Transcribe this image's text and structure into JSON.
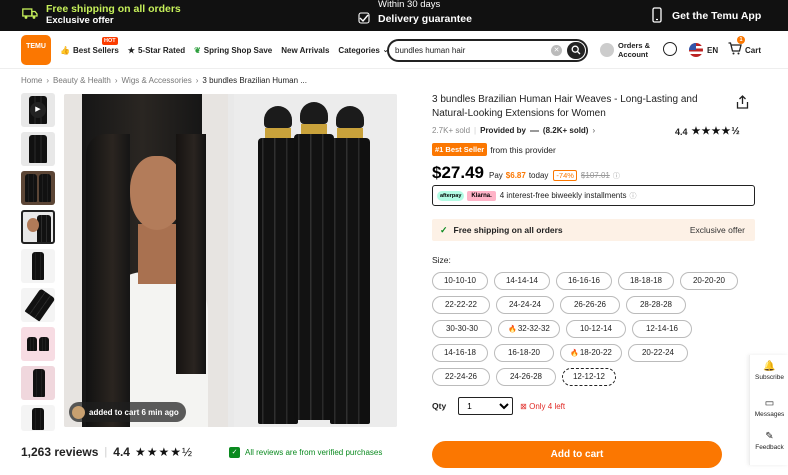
{
  "promo": {
    "free_shipping": "Free shipping on all orders",
    "exclusive_offer": "Exclusive offer",
    "within_days": "Within 30 days",
    "delivery_guarantee": "Delivery guarantee",
    "get_app": "Get the Temu App"
  },
  "nav": {
    "logo_text": "TEMU",
    "items": [
      {
        "label": "Best Sellers",
        "icon": "thumbs-up-icon"
      },
      {
        "label": "5-Star Rated",
        "icon": "star-icon"
      },
      {
        "label": "Spring Shop Save",
        "icon": "leaf-icon"
      },
      {
        "label": "New Arrivals",
        "icon": ""
      },
      {
        "label": "Categories",
        "icon": "chevron-down-icon"
      }
    ],
    "hot_badge": "HOT",
    "search_value": "bundles human hair",
    "account_label": "Orders & Account",
    "language": "EN",
    "cart_label": "Cart",
    "cart_count": "1"
  },
  "breadcrumb": {
    "home": "Home",
    "sep": "›",
    "level1": "Beauty & Health",
    "level2": "Wigs & Accessories",
    "current": "3 bundles Brazilian Human ..."
  },
  "gallery": {
    "toast": "added to cart 6 min ago"
  },
  "reviews": {
    "count": "1,263 reviews",
    "rating": "4.4",
    "stars": "★★★★½",
    "verified": "All reviews are from verified purchases"
  },
  "product": {
    "title": "3 bundles Brazilian Human Hair Weaves - Long-Lasting and Natural-Looking Extensions for Women",
    "sold": "2.7K+ sold",
    "provided_by": "Provided by",
    "provider_name": "(8.2K+ sold)",
    "rating": "4.4",
    "stars": "★★★★½",
    "best_seller": "#1 Best Seller",
    "best_from": "from this provider",
    "price": "$27.49",
    "pay": "Pay",
    "pay_amount": "$6.87",
    "today": "today",
    "discount": "-74%",
    "old_price": "$107.01",
    "bnpl_afterpay": "afterpay",
    "bnpl_klarna": "Klarna.",
    "bnpl_text": "4 interest-free biweekly installments",
    "shipping": "Free shipping on all orders",
    "exclusive": "Exclusive offer",
    "size_label": "Size:",
    "sizes": [
      "10-10-10",
      "14-14-14",
      "16-16-16",
      "18-18-18",
      "20-20-20",
      "22-22-22",
      "24-24-24",
      "26-26-26",
      "28-28-28",
      "30-30-30",
      "32-32-32",
      "10-12-14",
      "12-14-16",
      "14-16-18",
      "16-18-20",
      "18-20-22",
      "20-22-24",
      "22-24-26",
      "24-26-28",
      "12-12-12"
    ],
    "selected_size": "12-12-12",
    "hot_sizes": [
      "32-32-32",
      "18-20-22"
    ],
    "qty_label": "Qty",
    "qty_value": "1",
    "stock": "Only 4 left",
    "add_to_cart": "Add to cart"
  },
  "side": {
    "subscribe": "Subscribe",
    "messages": "Messages",
    "feedback": "Feedback"
  },
  "colors": {
    "accent": "#fb7701",
    "promo_green": "#c6f05a",
    "verified_green": "#0a8a1f",
    "stock_red": "#e02b27"
  }
}
